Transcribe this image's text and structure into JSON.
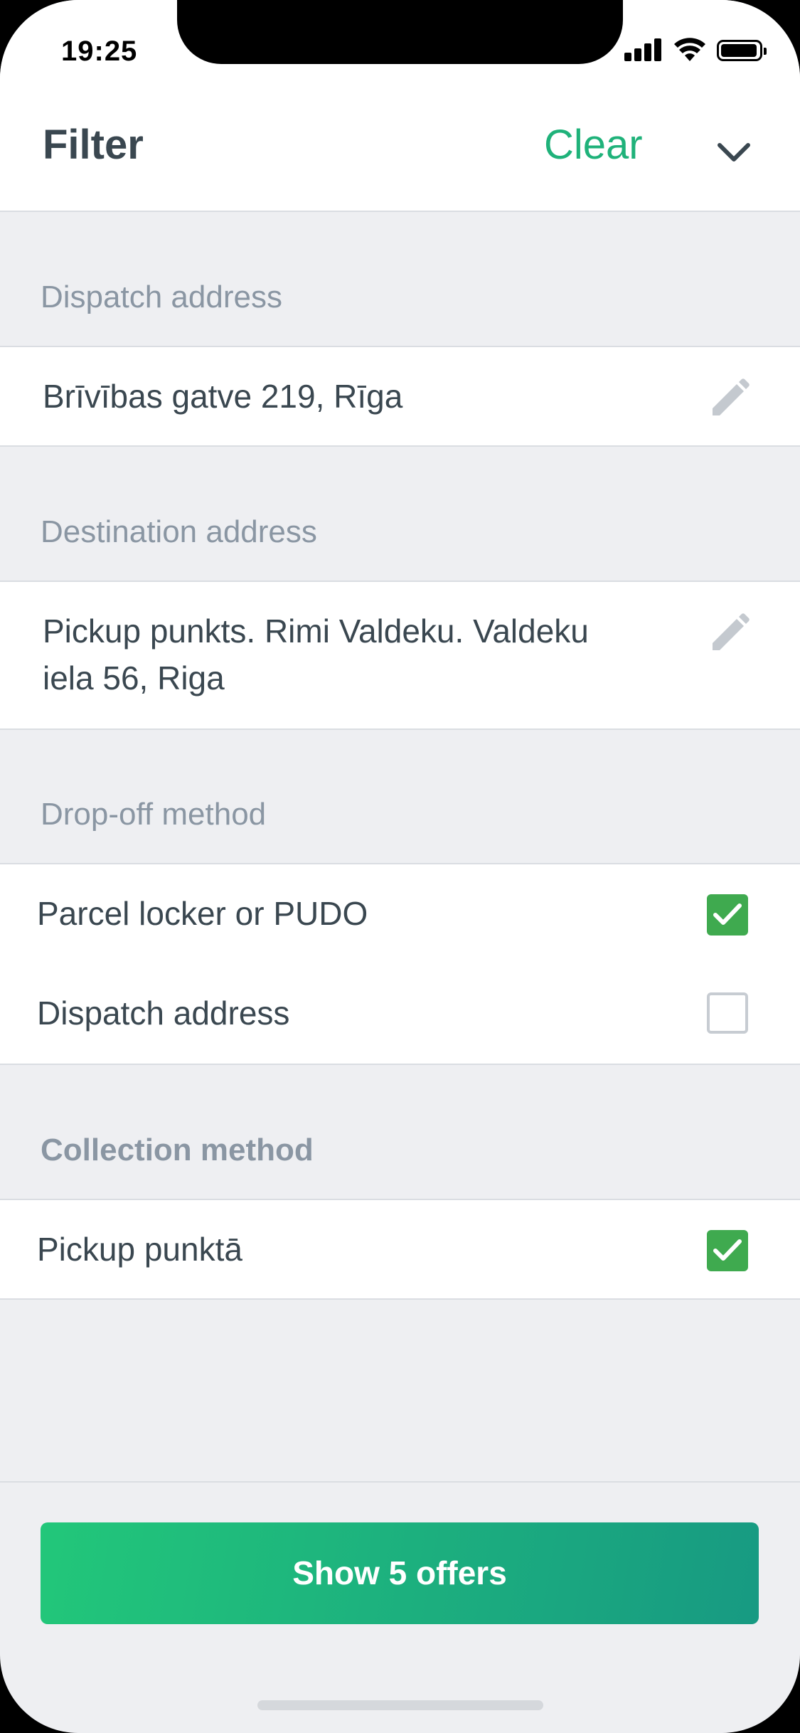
{
  "status_bar": {
    "time": "19:25"
  },
  "header": {
    "title": "Filter",
    "clear_label": "Clear"
  },
  "sections": {
    "dispatch": {
      "label": "Dispatch address",
      "value": "Brīvības gatve 219, Rīga"
    },
    "destination": {
      "label": "Destination address",
      "value_line1": "Pickup punkts. Rimi Valdeku. Valdeku",
      "value_line2": "iela 56, Riga"
    },
    "dropoff": {
      "label": "Drop-off method",
      "options": [
        {
          "label": "Parcel locker or PUDO",
          "checked": true
        },
        {
          "label": "Dispatch address",
          "checked": false
        }
      ]
    },
    "collection": {
      "label": "Collection method",
      "options": [
        {
          "label": "Pickup punktā",
          "checked": true
        }
      ]
    }
  },
  "cta": {
    "label": "Show 5 offers"
  },
  "colors": {
    "accent": "#1FB27A",
    "check": "#3FAA4F",
    "text": "#3A4750",
    "muted": "#8A96A3",
    "background": "#EEEFF2"
  }
}
